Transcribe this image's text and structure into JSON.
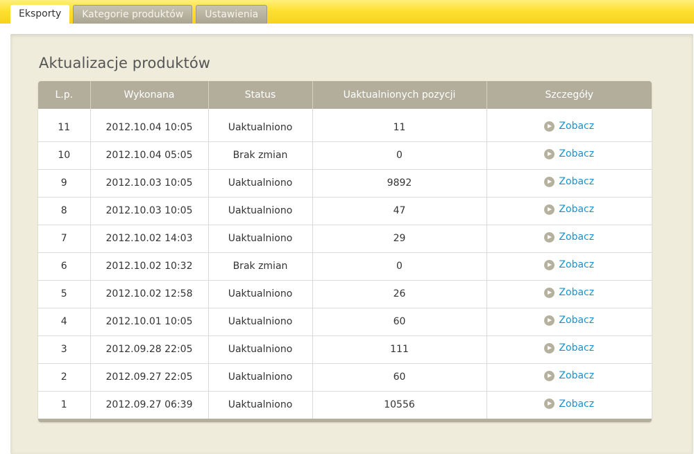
{
  "tabs": [
    {
      "label": "Eksporty",
      "active": true
    },
    {
      "label": "Kategorie produktów",
      "active": false
    },
    {
      "label": "Ustawienia",
      "active": false
    }
  ],
  "page": {
    "title": "Aktualizacje produktów"
  },
  "table": {
    "headers": [
      "L.p.",
      "Wykonana",
      "Status",
      "Uaktualnionych pozycji",
      "Szczegóły"
    ],
    "link_label": "Zobacz",
    "rows": [
      {
        "lp": "11",
        "date": "2012.10.04 10:05",
        "status": "Uaktualniono",
        "count": "11"
      },
      {
        "lp": "10",
        "date": "2012.10.04 05:05",
        "status": "Brak zmian",
        "count": "0"
      },
      {
        "lp": "9",
        "date": "2012.10.03 10:05",
        "status": "Uaktualniono",
        "count": "9892"
      },
      {
        "lp": "8",
        "date": "2012.10.03 10:05",
        "status": "Uaktualniono",
        "count": "47"
      },
      {
        "lp": "7",
        "date": "2012.10.02 14:03",
        "status": "Uaktualniono",
        "count": "29"
      },
      {
        "lp": "6",
        "date": "2012.10.02 10:32",
        "status": "Brak zmian",
        "count": "0"
      },
      {
        "lp": "5",
        "date": "2012.10.02 12:58",
        "status": "Uaktualniono",
        "count": "26"
      },
      {
        "lp": "4",
        "date": "2012.10.01 10:05",
        "status": "Uaktualniono",
        "count": "60"
      },
      {
        "lp": "3",
        "date": "2012.09.28 22:05",
        "status": "Uaktualniono",
        "count": "111"
      },
      {
        "lp": "2",
        "date": "2012.09.27 22:05",
        "status": "Uaktualniono",
        "count": "60"
      },
      {
        "lp": "1",
        "date": "2012.09.27 06:39",
        "status": "Uaktualniono",
        "count": "10556"
      }
    ]
  },
  "colors": {
    "topbar": "#fde033",
    "panel": "#efecdc",
    "header": "#b3ae9c",
    "link": "#1a8fd0"
  }
}
